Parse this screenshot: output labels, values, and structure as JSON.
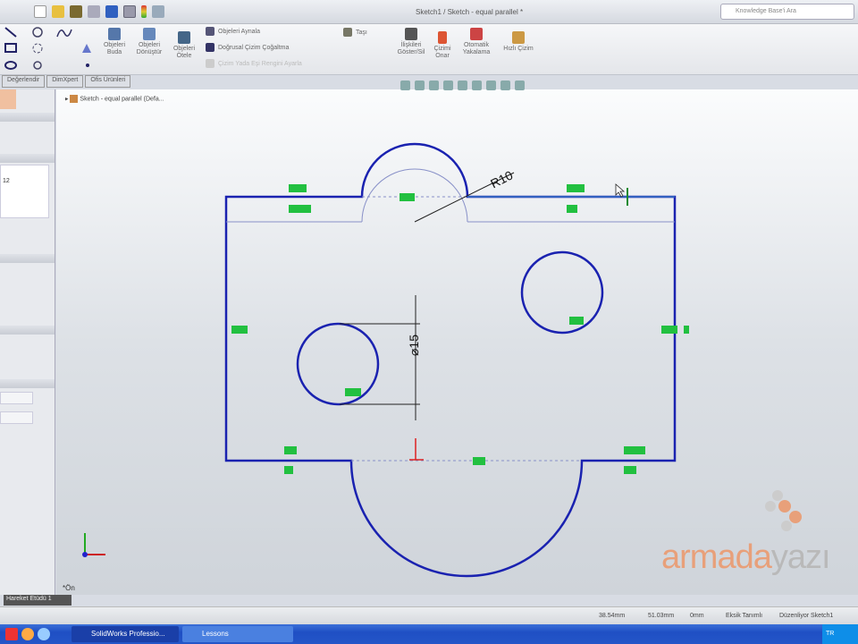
{
  "window": {
    "title": "Sketch1 / Sketch - equal parallel *",
    "search_placeholder": "Knowledge Base'i Ara"
  },
  "ribbon": {
    "trim": "Objeleri Buda",
    "convert": "Objeleri Dönüştür",
    "offset": "Objeleri Ötele",
    "mirror": "Objeleri Aynala",
    "linear_pattern": "Doğrusal Çizim Çoğaltma",
    "move": "Çizim Yada Eşi Rengini Ayarla",
    "tasi": "Taşı",
    "show_relations": "İlişkileri Göster/Sil",
    "repair": "Çizimi Onar",
    "quick_snaps": "Otomatik Yakalama",
    "rapid_sketch": "Hızlı Çizim"
  },
  "tabs": [
    "Değerlendir",
    "DimXpert",
    "Ofis Ürünleri"
  ],
  "tree": {
    "root": "Sketch - equal parallel (Defa..."
  },
  "left_panel": {
    "value": "12"
  },
  "sketch": {
    "radius_dim": "R10",
    "diameter_dim": "⌀15",
    "origin_label": "*Ön",
    "colors": {
      "line": "#1a22b0",
      "relation": "#22c040"
    }
  },
  "bottom_tab": "Hareket Etüdü 1",
  "status": {
    "x": "38.54mm",
    "y": "51.03mm",
    "z": "0mm",
    "state": "Eksik Tanımlı",
    "mode": "Düzenliyor Sketch1"
  },
  "taskbar": {
    "items": [
      "SolidWorks Professio...",
      "Lessons"
    ],
    "tray": "TR"
  },
  "logo": {
    "text_a": "armada",
    "text_b": "yazı"
  }
}
